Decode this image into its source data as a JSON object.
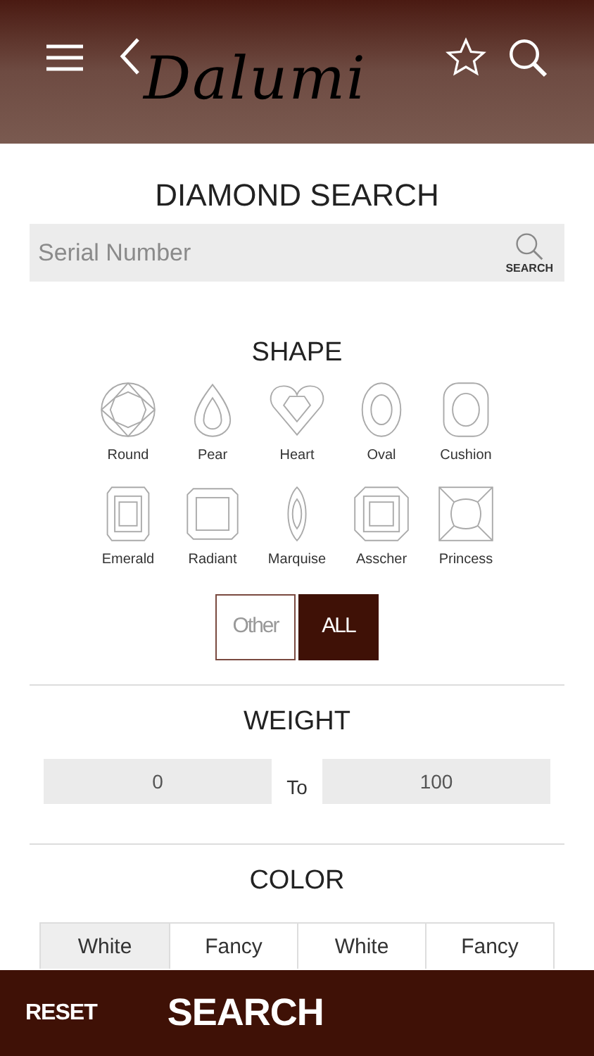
{
  "header": {
    "logo": "Dalumi"
  },
  "title": "DIAMOND SEARCH",
  "search": {
    "placeholder": "Serial Number",
    "button": "SEARCH"
  },
  "shape": {
    "heading": "SHAPE",
    "items": [
      {
        "label": "Round",
        "kind": "round"
      },
      {
        "label": "Pear",
        "kind": "pear"
      },
      {
        "label": "Heart",
        "kind": "heart"
      },
      {
        "label": "Oval",
        "kind": "oval"
      },
      {
        "label": "Cushion",
        "kind": "cushion"
      },
      {
        "label": "Emerald",
        "kind": "emerald"
      },
      {
        "label": "Radiant",
        "kind": "radiant"
      },
      {
        "label": "Marquise",
        "kind": "marquise"
      },
      {
        "label": "Asscher",
        "kind": "asscher"
      },
      {
        "label": "Princess",
        "kind": "princess"
      }
    ],
    "filters": [
      {
        "label": "Other",
        "selected": false
      },
      {
        "label": "ALL",
        "selected": true
      }
    ]
  },
  "weight": {
    "heading": "WEIGHT",
    "from": "0",
    "separator": "To",
    "to": "100"
  },
  "color": {
    "heading": "COLOR",
    "tabs": [
      {
        "label": "White",
        "selected": true
      },
      {
        "label": "Fancy",
        "selected": false
      },
      {
        "label": "White",
        "selected": false
      },
      {
        "label": "Fancy",
        "selected": false
      }
    ]
  },
  "bottom_bar": {
    "reset": "RESET",
    "search": "SEARCH"
  }
}
